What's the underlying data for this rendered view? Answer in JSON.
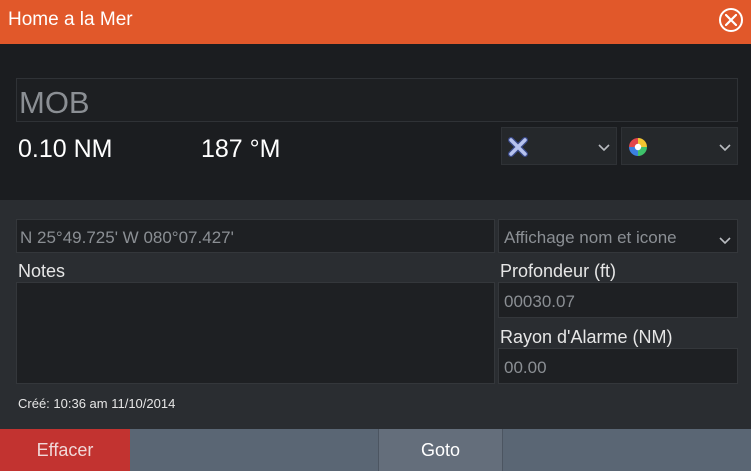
{
  "window": {
    "title": "Home a la Mer"
  },
  "waypoint": {
    "name": "MOB",
    "distance": "0.10 NM",
    "bearing": "187 °M",
    "symbol_icon": "crossed-x-icon",
    "color_icon": "color-wheel-icon"
  },
  "details": {
    "position": "N 25°49.725'   W 080°07.427'",
    "display_option": "Affichage nom et icone",
    "notes_label": "Notes",
    "notes_value": "",
    "depth_label": "Profondeur (ft)",
    "depth_value": "00030.07",
    "alarm_label": "Rayon d'Alarme (NM)",
    "alarm_value": "00.00",
    "created": "Créé: 10:36 am  11/10/2014"
  },
  "footer": {
    "delete_label": "Effacer",
    "goto_label": "Goto"
  },
  "colors": {
    "titlebar": "#e1582a",
    "delete": "#c23330",
    "footer": "#5a6674"
  }
}
